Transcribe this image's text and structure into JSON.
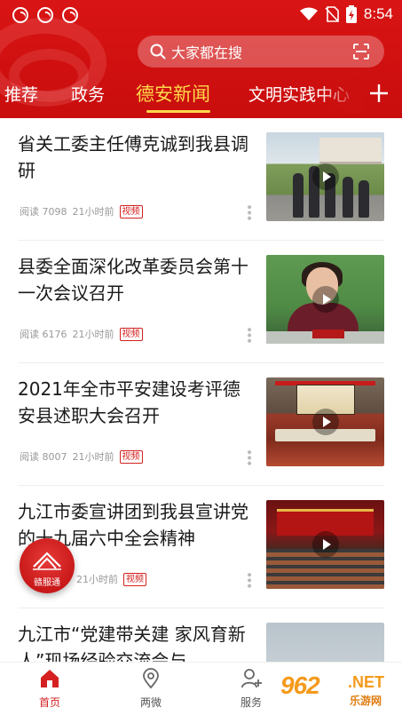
{
  "status_bar": {
    "time": "8:54"
  },
  "search": {
    "placeholder": "大家都在搜"
  },
  "tabs": [
    {
      "label": "推荐"
    },
    {
      "label": "政务"
    },
    {
      "label": "德安新闻",
      "active": true
    },
    {
      "label": "文明实践中心"
    }
  ],
  "news": [
    {
      "title": "省关工委主任傅克诚到我县调研",
      "reads": "阅读 7098",
      "time": "21小时前",
      "badge": "视频"
    },
    {
      "title": "县委全面深化改革委员会第十一次会议召开",
      "reads": "阅读 6176",
      "time": "21小时前",
      "badge": "视频"
    },
    {
      "title": "2021年全市平安建设考评德安县述职大会召开",
      "reads": "阅读 8007",
      "time": "21小时前",
      "badge": "视频"
    },
    {
      "title": "九江市委宣讲团到我县宣讲党的十九届六中全会精神",
      "reads": "阅读",
      "time": "21小时前",
      "badge": "视频"
    },
    {
      "title": "九江市“党建带关建 家风育新人”现场经验交流会与",
      "reads": "",
      "time": "",
      "badge": ""
    }
  ],
  "float_button": {
    "label": "赣服通"
  },
  "bottom_nav": [
    {
      "label": "首页",
      "active": true
    },
    {
      "label": "两微"
    },
    {
      "label": "服务"
    }
  ],
  "watermark": {
    "text": "962",
    "suffix": ".NET",
    "cn": "乐游网"
  },
  "colors": {
    "brand_red": "#d42020",
    "tab_active": "#ffd84a"
  }
}
